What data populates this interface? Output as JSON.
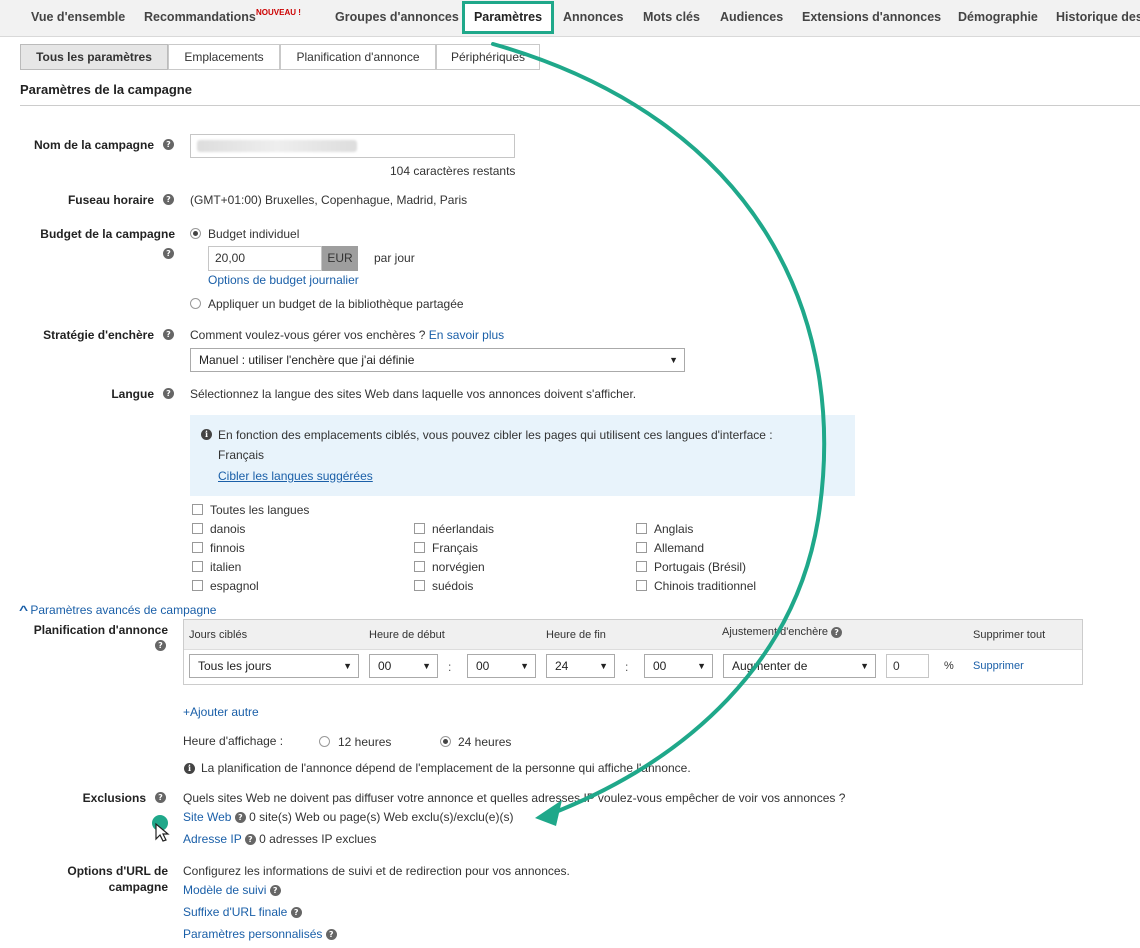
{
  "nav": {
    "tabs": [
      "Vue d'ensemble",
      "Recommandations",
      "Groupes d'annonces",
      "Paramètres",
      "Annonces",
      "Mots clés",
      "Audiences",
      "Extensions d'annonces",
      "Démographie",
      "Historique des"
    ],
    "new_badge": "NOUVEAU !"
  },
  "subtabs": [
    "Tous les paramètres",
    "Emplacements",
    "Planification d'annonce",
    "Périphériques"
  ],
  "section_title": "Paramètres de la campagne",
  "campaign_name": {
    "label": "Nom de la campagne",
    "remaining": "104 caractères restants"
  },
  "timezone": {
    "label": "Fuseau horaire",
    "value": "(GMT+01:00) Bruxelles, Copenhague, Madrid, Paris"
  },
  "budget": {
    "label": "Budget de la campagne",
    "individual": "Budget individuel",
    "amount": "20,00",
    "currency": "EUR",
    "per_day": "par jour",
    "options_link": "Options de budget journalier",
    "shared": "Appliquer un budget de la bibliothèque partagée"
  },
  "bid": {
    "label": "Stratégie d'enchère",
    "question": "Comment voulez-vous gérer vos enchères ?",
    "learn_more": "En savoir plus",
    "selected": "Manuel : utiliser l'enchère que j'ai définie"
  },
  "language": {
    "label": "Langue",
    "intro": "Sélectionnez la langue des sites Web dans laquelle vos annonces doivent s'afficher.",
    "info": "En fonction des emplacements ciblés, vous pouvez cibler les pages qui utilisent ces langues d'interface :",
    "suggested": "Français",
    "target_link": "Cibler les langues suggérées",
    "all": "Toutes les langues",
    "col1": [
      "danois",
      "finnois",
      "italien",
      "espagnol"
    ],
    "col2": [
      "néerlandais",
      "Français",
      "norvégien",
      "suédois"
    ],
    "col3": [
      "Anglais",
      "Allemand",
      "Portugais (Brésil)",
      "Chinois traditionnel"
    ]
  },
  "advanced_toggle": "Paramètres avancés de campagne",
  "schedule": {
    "label": "Planification d'annonce",
    "headers": {
      "days": "Jours ciblés",
      "start": "Heure de début",
      "end": "Heure de fin",
      "adjust": "Ajustement d'enchère",
      "delete_all": "Supprimer tout"
    },
    "days": "Tous les jours",
    "start_h": "00",
    "start_m": "00",
    "end_h": "24",
    "end_m": "00",
    "colon": ":",
    "adjust": "Augmenter de",
    "percent_value": "0",
    "percent_sign": "%",
    "delete": "Supprimer",
    "add_other": "+Ajouter autre",
    "display_time_label": "Heure d'affichage :",
    "h12": "12 heures",
    "h24": "24 heures",
    "note": "La planification de l'annonce dépend de l'emplacement de la personne qui affiche l'annonce."
  },
  "exclusions": {
    "label": "Exclusions",
    "question": "Quels sites Web ne doivent pas diffuser votre annonce et quelles adresses IP voulez-vous empêcher de voir vos annonces ?",
    "site_link": "Site Web",
    "site_count": "0 site(s) Web ou page(s) Web exclu(s)/exclu(e)(s)",
    "ip_link": "Adresse IP",
    "ip_count": "0 adresses IP exclues"
  },
  "url_options": {
    "label_line1": "Options d'URL de",
    "label_line2": "campagne",
    "desc": "Configurez les informations de suivi et de redirection pour vos annonces.",
    "tracking": "Modèle de suivi",
    "suffix": "Suffixe d'URL finale",
    "custom": "Paramètres personnalisés"
  },
  "colors": {
    "accent": "#1fa88a",
    "link": "#1a5fa8",
    "info_bg": "#e8f3fb"
  },
  "icons": [
    "help-icon",
    "info-icon",
    "radio-icon",
    "checkbox-icon",
    "chevron-up-icon",
    "dropdown-arrow-icon",
    "cursor-icon",
    "arrow-annotation-icon"
  ]
}
